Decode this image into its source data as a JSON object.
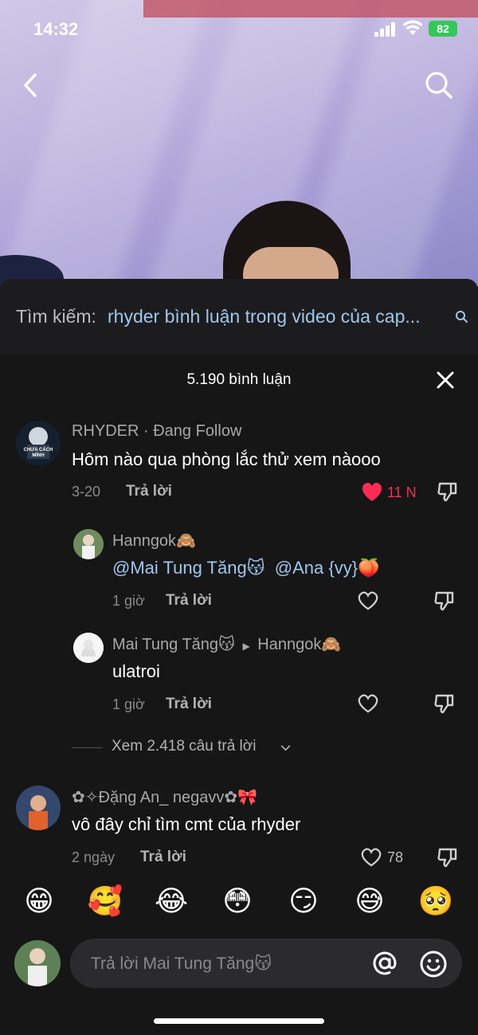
{
  "status_bar": {
    "time": "14:32",
    "battery": "82"
  },
  "search_suggestion": {
    "prefix": "Tìm kiếm:",
    "query": "rhyder bình luận trong video của cap..."
  },
  "panel": {
    "title": "5.190 bình luận"
  },
  "comments": [
    {
      "name": "RHYDER · Đang Follow",
      "text": "Hôm nào qua phòng lắc thử xem nàooo",
      "time": "3-20",
      "reply_label": "Trả lời",
      "likes": "11 N",
      "liked": true,
      "avatar_caption": "CHƯA CÁCH MÌNH"
    },
    {
      "name": "Hanngok🙈",
      "mention_1": "@Mai Tung Tăng😽",
      "mention_2": "@Ana {vy}🍑",
      "time": "1 giờ",
      "reply_label": "Trả lời"
    },
    {
      "name": "Mai Tung Tăng😽",
      "reply_to": "Hanngok🙈",
      "text": "ulatroi",
      "time": "1 giờ",
      "reply_label": "Trả lời"
    },
    {
      "name": "✿✧Đặng An_ negavv✿🎀",
      "text": "vô đây chỉ tìm cmt của rhyder",
      "time": "2 ngày",
      "reply_label": "Trả lời",
      "likes": "78"
    }
  ],
  "view_more": "Xem 2.418 câu trả lời",
  "emojis": [
    "😁",
    "🥰",
    "😂",
    "😳",
    "😏",
    "😅",
    "🥺"
  ],
  "input": {
    "placeholder": "Trả lời Mai Tung Tăng😽"
  },
  "colors": {
    "accent_link": "#9ec7ee",
    "like_red": "#fe2c55",
    "panel_bg": "#161616"
  }
}
